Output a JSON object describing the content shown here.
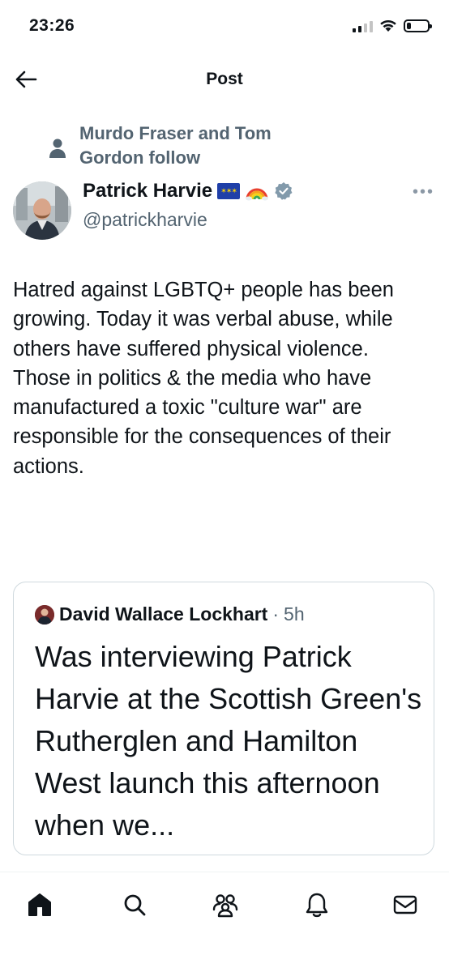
{
  "status_bar": {
    "time": "23:26",
    "signal_icon": "signal-bars-icon",
    "wifi_icon": "wifi-icon",
    "battery_icon": "battery-icon",
    "battery_level": 0.2
  },
  "header": {
    "title": "Post",
    "back_icon": "arrow-left-icon"
  },
  "social_context": {
    "icon": "person-icon",
    "text": "Murdo Fraser and Tom Gordon follow"
  },
  "author": {
    "name": "Patrick Harvie",
    "flag_icon": "eu-flag-icon",
    "rainbow_icon": "rainbow-icon",
    "verified_icon": "verified-badge-icon",
    "handle": "@patrickharvie",
    "more_icon": "more-options-icon",
    "more_label": "•••"
  },
  "post": {
    "lines": [
      "Hatred against LGBTQ+ people has been growing. Today it was verbal abuse, while others have suffered physical violence.",
      "Those in politics & the media who have manufactured a toxic \"culture war\" are responsible for the consequences of their actions."
    ]
  },
  "quote": {
    "author_name": "David Wallace Lockhart",
    "separator": "·",
    "time": "5h",
    "text": "Was interviewing Patrick Harvie at the Scottish Green's Rutherglen and Hamilton West launch this afternoon when we..."
  },
  "bottom_nav": {
    "items": [
      {
        "icon": "home-icon",
        "active": true
      },
      {
        "icon": "search-icon",
        "active": false
      },
      {
        "icon": "communities-icon",
        "active": false
      },
      {
        "icon": "notifications-bell-icon",
        "active": false
      },
      {
        "icon": "messages-envelope-icon",
        "active": false
      }
    ]
  },
  "colors": {
    "text": "#0f1419",
    "secondary": "#536471",
    "border": "#cfd9de",
    "verified_badge": "#829aab"
  }
}
